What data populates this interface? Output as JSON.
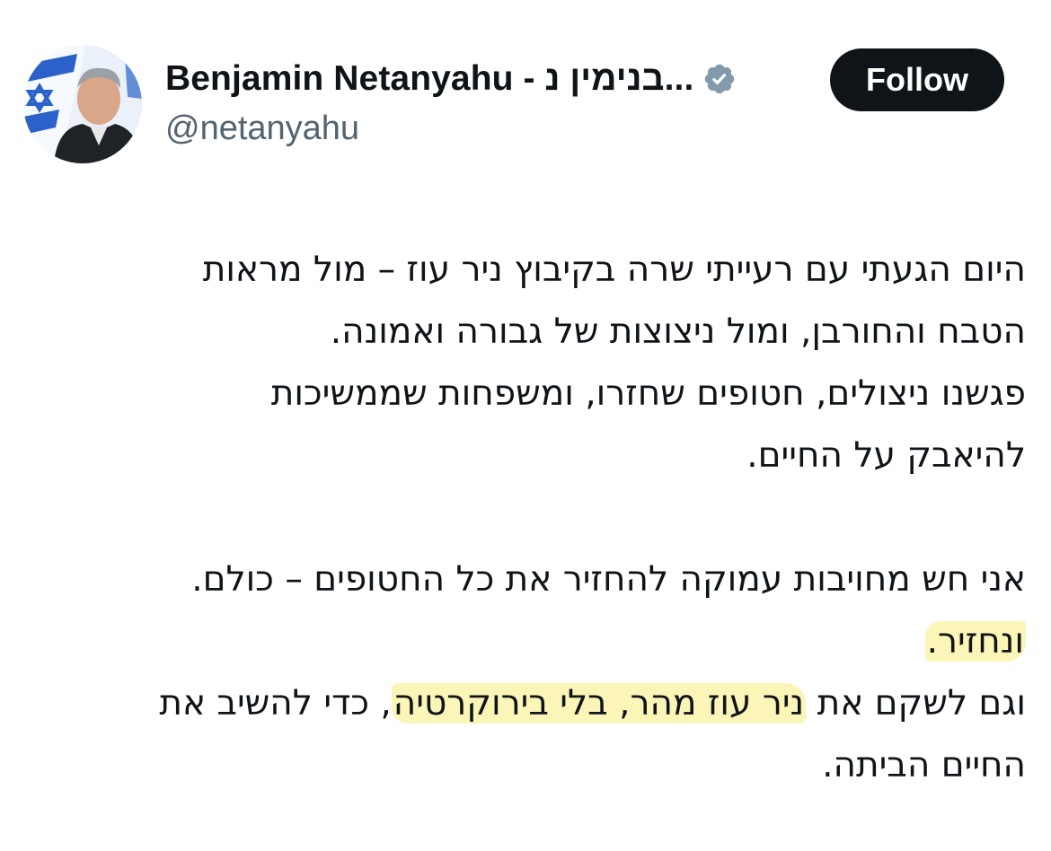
{
  "author": {
    "display_name": "Benjamin Netanyahu - בנימין נ...",
    "handle": "@netanyahu",
    "verified_icon": "verified-badge-icon",
    "verified_color": "#829aab"
  },
  "follow_button": {
    "label": "Follow"
  },
  "tweet": {
    "line1": "היום הגעתי עם רעייתי שרה בקיבוץ ניר עוז – מול מראות",
    "line2": "הטבח והחורבן, ומול ניצוצות של גבורה ואמונה.",
    "line3": "פגשנו ניצולים, חטופים שחזרו, ומשפחות שממשיכות",
    "line4": "להיאבק על החיים.",
    "line5": "אני חש מחויבות עמוקה להחזיר את כל החטופים – כולם.",
    "line6": "ונחזיר.",
    "line7_part1": "וגם לשקם את ",
    "line7_highlight": "ניר עוז מהר, בלי בירוקרטיה",
    "line7_part2": ", כדי להשיב את",
    "line8": "החיים הביתה.",
    "highlight_color": "#fbf5b8"
  }
}
